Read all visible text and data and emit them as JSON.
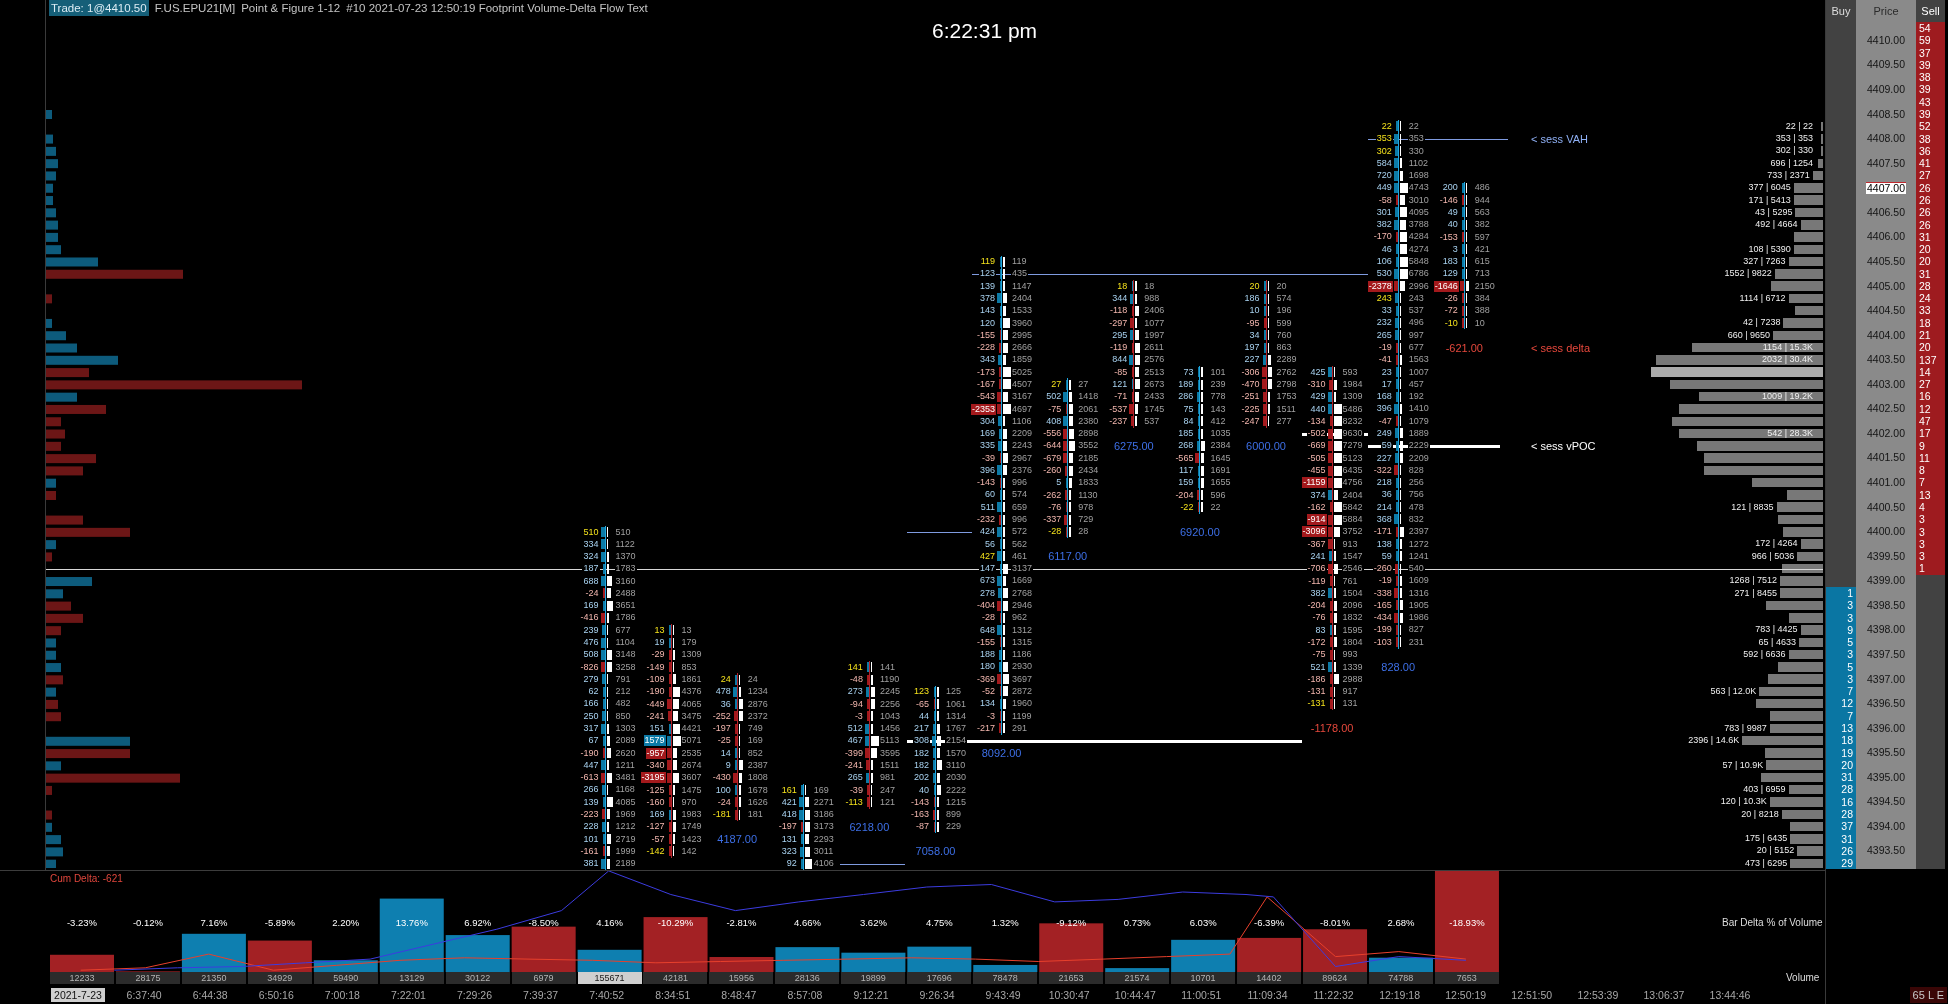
{
  "header": {
    "trade": "Trade: 1@4410.50",
    "instrument": "F.US.EPU21[M]",
    "chart_type": "Point & Figure 1-12",
    "description": "#10 2021-07-23 12:50:19 Footprint Volume-Delta Flow Text"
  },
  "clock": "6:22:31 pm",
  "footprint": {
    "columns": [
      {
        "rising": true,
        "rows": [
          [
            "510",
            "510",
            true
          ],
          [
            "334",
            "1122",
            false
          ],
          [
            "324",
            "1370",
            false
          ],
          [
            "187",
            "1783",
            false
          ],
          [
            "688",
            "3160",
            false
          ],
          [
            "-24",
            "2488",
            false
          ],
          [
            "169",
            "3651",
            false
          ],
          [
            "-416",
            "1786",
            false
          ],
          [
            "239",
            "677",
            false
          ],
          [
            "476",
            "1104",
            false
          ],
          [
            "508",
            "3148",
            false
          ],
          [
            "-826",
            "3258",
            false
          ],
          [
            "279",
            "791",
            false
          ],
          [
            "62",
            "212",
            false
          ],
          [
            "166",
            "482",
            false
          ],
          [
            "250",
            "850",
            false
          ],
          [
            "317",
            "1303",
            false
          ],
          [
            "67",
            "2089",
            false
          ],
          [
            "-190",
            "2620",
            false
          ],
          [
            "447",
            "1211",
            false
          ],
          [
            "-613",
            "3481",
            false
          ],
          [
            "266",
            "1168",
            false
          ],
          [
            "139",
            "4085",
            false
          ],
          [
            "-223",
            "1969",
            false
          ],
          [
            "228",
            "1212",
            false
          ],
          [
            "101",
            "2719",
            false
          ],
          [
            "-161",
            "1999",
            false
          ],
          [
            "381",
            "2189",
            false
          ]
        ]
      },
      {
        "rising": false,
        "rows": [
          [
            "13",
            "13",
            true
          ],
          [
            "19",
            "179",
            false
          ],
          [
            "-29",
            "1309",
            false
          ],
          [
            "-149",
            "853",
            false
          ],
          [
            "-109",
            "1861",
            false
          ],
          [
            "-190",
            "4376",
            false
          ],
          [
            "-449",
            "4065",
            false
          ],
          [
            "-241",
            "3475",
            false
          ],
          [
            "151",
            "4421",
            false
          ],
          [
            "1579",
            "5071",
            false
          ],
          [
            "-957",
            "2535",
            false
          ],
          [
            "-340",
            "2674",
            false
          ],
          [
            "-3195",
            "3607",
            false
          ],
          [
            "-125",
            "1475",
            false
          ],
          [
            "-160",
            "970",
            false
          ],
          [
            "169",
            "1983",
            false
          ],
          [
            "-127",
            "1749",
            false
          ],
          [
            "-57",
            "1423",
            false
          ],
          [
            "-142",
            "142",
            true
          ]
        ]
      },
      {
        "rising": false,
        "rows": [
          [
            "24",
            "24",
            true
          ],
          [
            "478",
            "1234",
            false
          ],
          [
            "36",
            "2876",
            false
          ],
          [
            "-252",
            "2372",
            false
          ],
          [
            "-197",
            "749",
            false
          ],
          [
            "-25",
            "169",
            false
          ],
          [
            "14",
            "852",
            false
          ],
          [
            "9",
            "2387",
            false
          ],
          [
            "-430",
            "1808",
            false
          ],
          [
            "100",
            "1678",
            false
          ],
          [
            "-24",
            "1626",
            false
          ],
          [
            "-181",
            "181",
            true
          ]
        ],
        "total": "4187.00"
      },
      {
        "rising": true,
        "rows": [
          [
            "161",
            "169",
            true
          ],
          [
            "421",
            "2271",
            false
          ],
          [
            "418",
            "3186",
            false
          ],
          [
            "-197",
            "3173",
            false
          ],
          [
            "131",
            "2293",
            false
          ],
          [
            "323",
            "3011",
            false
          ],
          [
            "92",
            "4106",
            false
          ]
        ]
      },
      {
        "rising": false,
        "rows": [
          [
            "141",
            "141",
            true
          ],
          [
            "-48",
            "1190",
            false
          ],
          [
            "273",
            "2245",
            false
          ],
          [
            "-94",
            "2256",
            false
          ],
          [
            "-3",
            "1043",
            false
          ],
          [
            "512",
            "1456",
            false
          ],
          [
            "467",
            "5113",
            false
          ],
          [
            "-399",
            "3595",
            false
          ],
          [
            "-241",
            "1511",
            false
          ],
          [
            "265",
            "981",
            false
          ],
          [
            "-39",
            "247",
            false
          ],
          [
            "-113",
            "121",
            true
          ]
        ],
        "total": "6218.00"
      },
      {
        "rising": true,
        "rows": [
          [
            "123",
            "125",
            true
          ],
          [
            "-65",
            "1061",
            false
          ],
          [
            "44",
            "1314",
            false
          ],
          [
            "217",
            "1767",
            false
          ],
          [
            "308",
            "2154",
            false
          ],
          [
            "182",
            "1570",
            false
          ],
          [
            "182",
            "3110",
            false
          ],
          [
            "202",
            "2030",
            false
          ],
          [
            "40",
            "2222",
            false
          ],
          [
            "-143",
            "1215",
            false
          ],
          [
            "-163",
            "899",
            false
          ],
          [
            "-87",
            "229",
            false
          ]
        ],
        "total": "7058.00"
      },
      {
        "rising": true,
        "rows": [
          [
            "119",
            "119",
            true
          ],
          [
            "123",
            "435",
            false
          ],
          [
            "139",
            "1147",
            false
          ],
          [
            "378",
            "2404",
            false
          ],
          [
            "143",
            "1533",
            false
          ],
          [
            "120",
            "3960",
            false
          ],
          [
            "-155",
            "2995",
            false
          ],
          [
            "-228",
            "2666",
            false
          ],
          [
            "343",
            "1859",
            false
          ],
          [
            "-173",
            "5025",
            false
          ],
          [
            "-167",
            "4507",
            false
          ],
          [
            "-543",
            "3167",
            false
          ],
          [
            "-2353",
            "4697",
            false
          ],
          [
            "304",
            "1106",
            false
          ],
          [
            "169",
            "2209",
            false
          ],
          [
            "335",
            "2243",
            false
          ],
          [
            "-39",
            "2967",
            false
          ],
          [
            "396",
            "2376",
            false
          ],
          [
            "-143",
            "996",
            false
          ],
          [
            "60",
            "574",
            false
          ],
          [
            "511",
            "659",
            false
          ],
          [
            "-232",
            "996",
            false
          ],
          [
            "424",
            "572",
            false
          ],
          [
            "56",
            "562",
            false
          ],
          [
            "427",
            "461",
            true
          ],
          [
            "147",
            "3137",
            false
          ],
          [
            "673",
            "1669",
            false
          ],
          [
            "278",
            "2768",
            false
          ],
          [
            "-404",
            "2946",
            false
          ],
          [
            "-28",
            "962",
            false
          ],
          [
            "648",
            "1312",
            false
          ],
          [
            "-155",
            "1315",
            false
          ],
          [
            "188",
            "1186",
            false
          ],
          [
            "180",
            "2930",
            false
          ],
          [
            "-369",
            "3697",
            false
          ],
          [
            "-52",
            "2872",
            false
          ],
          [
            "134",
            "1960",
            false
          ],
          [
            "-3",
            "1199",
            false
          ],
          [
            "-217",
            "291",
            false
          ]
        ],
        "total": "8092.00"
      },
      {
        "rising": true,
        "rows": [
          [
            "27",
            "27",
            true
          ],
          [
            "502",
            "1418",
            false
          ],
          [
            "-75",
            "2061",
            false
          ],
          [
            "408",
            "2380",
            false
          ],
          [
            "-556",
            "2898",
            false
          ],
          [
            "-644",
            "3552",
            false
          ],
          [
            "-679",
            "2185",
            false
          ],
          [
            "-260",
            "2434",
            false
          ],
          [
            "5",
            "1833",
            false
          ],
          [
            "-262",
            "1130",
            false
          ],
          [
            "-76",
            "978",
            false
          ],
          [
            "-337",
            "729",
            false
          ],
          [
            "-28",
            "28",
            true
          ]
        ],
        "total": "6117.00"
      },
      {
        "rising": false,
        "rows": [
          [
            "18",
            "18",
            true
          ],
          [
            "344",
            "988",
            false
          ],
          [
            "-118",
            "2406",
            false
          ],
          [
            "-297",
            "1077",
            false
          ],
          [
            "295",
            "1997",
            false
          ],
          [
            "-119",
            "2611",
            false
          ],
          [
            "844",
            "2576",
            false
          ],
          [
            "-85",
            "2513",
            false
          ],
          [
            "121",
            "2673",
            false
          ],
          [
            "-71",
            "2433",
            false
          ],
          [
            "-537",
            "1745",
            false
          ],
          [
            "-237",
            "537",
            false
          ]
        ],
        "total": "6275.00"
      },
      {
        "rising": true,
        "rows": [
          [
            "73",
            "101",
            false
          ],
          [
            "189",
            "239",
            false
          ],
          [
            "286",
            "778",
            false
          ],
          [
            "75",
            "143",
            false
          ],
          [
            "84",
            "412",
            false
          ],
          [
            "185",
            "1035",
            false
          ],
          [
            "268",
            "2384",
            false
          ],
          [
            "-565",
            "1645",
            false
          ],
          [
            "117",
            "1691",
            false
          ],
          [
            "159",
            "1655",
            false
          ],
          [
            "-204",
            "596",
            false
          ],
          [
            "-22",
            "22",
            true
          ]
        ],
        "total": "6920.00"
      },
      {
        "rising": false,
        "rows": [
          [
            "20",
            "20",
            true
          ],
          [
            "186",
            "574",
            false
          ],
          [
            "10",
            "196",
            false
          ],
          [
            "-95",
            "599",
            false
          ],
          [
            "34",
            "760",
            false
          ],
          [
            "197",
            "863",
            false
          ],
          [
            "227",
            "2289",
            false
          ],
          [
            "-306",
            "2762",
            false
          ],
          [
            "-470",
            "2798",
            false
          ],
          [
            "-251",
            "1753",
            false
          ],
          [
            "-225",
            "1511",
            false
          ],
          [
            "-247",
            "277",
            false
          ]
        ],
        "total": "6000.00"
      },
      {
        "rising": false,
        "rows": [
          [
            "425",
            "593",
            false
          ],
          [
            "-310",
            "1984",
            false
          ],
          [
            "429",
            "1309",
            false
          ],
          [
            "440",
            "5486",
            false
          ],
          [
            "-134",
            "8232",
            false
          ],
          [
            "-502",
            "9630",
            false
          ],
          [
            "-669",
            "7279",
            false
          ],
          [
            "-505",
            "5123",
            false
          ],
          [
            "-455",
            "6435",
            false
          ],
          [
            "-1159",
            "4756",
            false
          ],
          [
            "374",
            "2404",
            false
          ],
          [
            "-162",
            "5842",
            false
          ],
          [
            "-914",
            "5884",
            false
          ],
          [
            "-3096",
            "3752",
            false
          ],
          [
            "-367",
            "913",
            false
          ],
          [
            "241",
            "1547",
            false
          ],
          [
            "-706",
            "2546",
            false
          ],
          [
            "-119",
            "761",
            false
          ],
          [
            "382",
            "1504",
            false
          ],
          [
            "-204",
            "2096",
            false
          ],
          [
            "-76",
            "1832",
            false
          ],
          [
            "83",
            "1595",
            false
          ],
          [
            "-172",
            "1804",
            false
          ],
          [
            "-75",
            "993",
            false
          ],
          [
            "521",
            "1339",
            false
          ],
          [
            "-186",
            "2988",
            false
          ],
          [
            "-131",
            "917",
            false
          ],
          [
            "-131",
            "131",
            true
          ]
        ],
        "total": "-1178.00"
      },
      {
        "rising": true,
        "rows": [
          [
            "22",
            "22",
            true
          ],
          [
            "353",
            "353",
            true
          ],
          [
            "302",
            "330",
            true
          ],
          [
            "584",
            "1102",
            false
          ],
          [
            "720",
            "1698",
            false
          ],
          [
            "449",
            "4743",
            false
          ],
          [
            "-58",
            "3010",
            false
          ],
          [
            "301",
            "4095",
            false
          ],
          [
            "382",
            "3788",
            false
          ],
          [
            "-170",
            "4284",
            false
          ],
          [
            "46",
            "4274",
            false
          ],
          [
            "106",
            "5848",
            false
          ],
          [
            "530",
            "6786",
            false
          ],
          [
            "-2378",
            "2996",
            false
          ],
          [
            "243",
            "243",
            true
          ],
          [
            "33",
            "537",
            false
          ],
          [
            "232",
            "496",
            false
          ],
          [
            "265",
            "997",
            false
          ],
          [
            "-19",
            "677",
            false
          ],
          [
            "-41",
            "1563",
            false
          ],
          [
            "23",
            "1007",
            false
          ],
          [
            "17",
            "457",
            false
          ],
          [
            "168",
            "192",
            false
          ],
          [
            "396",
            "1410",
            false
          ],
          [
            "-47",
            "1079",
            false
          ],
          [
            "249",
            "1889",
            false
          ],
          [
            "59",
            "2229",
            false
          ],
          [
            "227",
            "2209",
            false
          ],
          [
            "-322",
            "828",
            false
          ],
          [
            "218",
            "256",
            false
          ],
          [
            "36",
            "756",
            false
          ],
          [
            "214",
            "478",
            false
          ],
          [
            "368",
            "832",
            false
          ],
          [
            "-171",
            "2397",
            false
          ],
          [
            "138",
            "1272",
            false
          ],
          [
            "59",
            "1241",
            false
          ],
          [
            "-260",
            "540",
            false
          ],
          [
            "-19",
            "1609",
            false
          ],
          [
            "-338",
            "1316",
            false
          ],
          [
            "-165",
            "1905",
            false
          ],
          [
            "-434",
            "1986",
            false
          ],
          [
            "-199",
            "827",
            false
          ],
          [
            "-103",
            "231",
            false
          ]
        ],
        "total": "828.00"
      },
      {
        "rising": true,
        "rows": [
          [
            "200",
            "486",
            false
          ],
          [
            "-146",
            "944",
            false
          ],
          [
            "49",
            "563",
            false
          ],
          [
            "40",
            "382",
            false
          ],
          [
            "-153",
            "597",
            false
          ],
          [
            "3",
            "421",
            false
          ],
          [
            "183",
            "615",
            false
          ],
          [
            "129",
            "713",
            false
          ],
          [
            "-1646",
            "2150",
            false
          ],
          [
            "-26",
            "384",
            false
          ],
          [
            "-72",
            "388",
            false
          ],
          [
            "-10",
            "10",
            true
          ]
        ],
        "total": "-621.00"
      }
    ]
  },
  "annotations": [
    {
      "kind": "vah",
      "text": "< sess VAH"
    },
    {
      "kind": "delta",
      "text": "< sess delta"
    },
    {
      "kind": "vpoc",
      "text": "< sess vPOC"
    }
  ],
  "ladder": {
    "headers": [
      "Buy",
      "Price",
      "Sell"
    ],
    "rows": [
      {
        "sell": "54",
        "selected": false
      },
      {
        "price": "4410.00",
        "sell": "59",
        "selected": false
      },
      {
        "sell": "37",
        "selected": false
      },
      {
        "price": "4409.50",
        "sell": "39",
        "selected": false
      },
      {
        "sell": "38",
        "selected": false
      },
      {
        "price": "4409.00",
        "sell": "39",
        "selected": false
      },
      {
        "sell": "43",
        "selected": false
      },
      {
        "price": "4408.50",
        "sell": "39",
        "selected": false
      },
      {
        "profile": "22 | 22",
        "level": 0.01,
        "sell": "52",
        "selected": false
      },
      {
        "profile": "353 | 353",
        "level": 0.01,
        "price": "4408.00",
        "sell": "38",
        "selected": false
      },
      {
        "profile": "302 | 330",
        "level": 0.01,
        "sell": "36",
        "selected": false
      },
      {
        "profile": "696 | 1254",
        "level": 0.03,
        "price": "4407.50",
        "sell": "41",
        "selected": false
      },
      {
        "profile": "733 | 2371",
        "level": 0.06,
        "sell": "27",
        "selected": false
      },
      {
        "profile": "377 | 6045",
        "level": 0.17,
        "price": "4407.00",
        "sell": "26",
        "selected": true
      },
      {
        "profile": "171 | 5413",
        "level": 0.17,
        "sell": "26",
        "selected": false
      },
      {
        "profile": "43 | 5295",
        "level": 0.16,
        "price": "4406.50",
        "sell": "26",
        "selected": false
      },
      {
        "profile": "492 | 4664",
        "level": 0.13,
        "sell": "26",
        "selected": false
      },
      {
        "level": 0.17,
        "price": "4406.00",
        "sell": "31",
        "selected": false
      },
      {
        "profile": "108 | 5390",
        "level": 0.17,
        "sell": "20",
        "selected": false
      },
      {
        "profile": "327 | 7263",
        "level": 0.2,
        "price": "4405.50",
        "sell": "20",
        "selected": false
      },
      {
        "profile": "1552 | 9822",
        "level": 0.28,
        "sell": "31",
        "selected": false
      },
      {
        "level": 0.3,
        "price": "4405.00",
        "sell": "28",
        "selected": false
      },
      {
        "profile": "1114 | 6712",
        "level": 0.2,
        "sell": "24",
        "selected": false
      },
      {
        "level": 0.16,
        "price": "4404.50",
        "sell": "33",
        "selected": false
      },
      {
        "profile": "42 | 7238",
        "level": 0.23,
        "sell": "18",
        "selected": false
      },
      {
        "profile": "660 | 9650",
        "level": 0.29,
        "price": "4404.00",
        "sell": "21",
        "selected": false
      },
      {
        "profile": "1154 | 15.3K",
        "level": 0.76,
        "sell": "20",
        "selected": false
      },
      {
        "profile": "2032 | 30.4K",
        "level": 0.97,
        "price": "4403.50",
        "sell": "137",
        "selected": false
      },
      {
        "level": 1,
        "sell": "14",
        "selected": false
      },
      {
        "level": 0.89,
        "price": "4403.00",
        "sell": "27",
        "selected": false
      },
      {
        "profile": "1009 | 19.2K",
        "level": 0.72,
        "sell": "16",
        "selected": false
      },
      {
        "level": 0.84,
        "price": "4402.50",
        "sell": "12",
        "selected": false
      },
      {
        "level": 0.88,
        "sell": "47",
        "selected": false
      },
      {
        "profile": "542 | 28.3K",
        "level": 0.84,
        "price": "4402.00",
        "sell": "17",
        "selected": false
      },
      {
        "level": 0.73,
        "sell": "9",
        "selected": false
      },
      {
        "level": 0.69,
        "price": "4401.50",
        "sell": "11",
        "selected": false
      },
      {
        "level": 0.69,
        "sell": "8",
        "selected": false
      },
      {
        "level": 0.41,
        "price": "4401.00",
        "sell": "7",
        "selected": false
      },
      {
        "level": 0.21,
        "sell": "13",
        "selected": false
      },
      {
        "profile": "121 | 8835",
        "level": 0.27,
        "price": "4400.50",
        "sell": "4",
        "selected": false
      },
      {
        "level": 0.26,
        "sell": "3",
        "selected": false
      },
      {
        "level": 0.23,
        "price": "4400.00",
        "sell": "3",
        "selected": false
      },
      {
        "profile": "172 | 4264",
        "level": 0.13,
        "sell": "3",
        "selected": false
      },
      {
        "profile": "966 | 5036",
        "level": 0.15,
        "price": "4399.50",
        "sell": "3",
        "selected": false
      },
      {
        "level": 0.24,
        "sell": "1",
        "selected": false
      },
      {
        "profile": "1268 | 7512",
        "level": 0.25,
        "price": "4399.00",
        "selected": false
      },
      {
        "profile": "271 | 8455",
        "level": 0.25,
        "buy": "1",
        "selected": false
      },
      {
        "level": 0.33,
        "price": "4398.50",
        "buy": "3",
        "selected": false
      },
      {
        "level": 0.2,
        "buy": "3",
        "selected": false
      },
      {
        "profile": "783 | 4425",
        "level": 0.13,
        "price": "4398.00",
        "buy": "9",
        "selected": false
      },
      {
        "profile": "65 | 4633",
        "level": 0.14,
        "buy": "5",
        "selected": false
      },
      {
        "profile": "592 | 6636",
        "level": 0.2,
        "price": "4397.50",
        "buy": "3",
        "selected": false
      },
      {
        "level": 0.26,
        "buy": "5",
        "selected": false
      },
      {
        "level": 0.32,
        "price": "4397.00",
        "buy": "3",
        "selected": false
      },
      {
        "profile": "563 | 12.0K",
        "level": 0.37,
        "buy": "7",
        "selected": false
      },
      {
        "level": 0.39,
        "price": "4396.50",
        "buy": "12",
        "selected": false
      },
      {
        "level": 0.31,
        "buy": "7",
        "selected": false
      },
      {
        "profile": "783 | 9987",
        "level": 0.31,
        "price": "4396.00",
        "buy": "13",
        "selected": false
      },
      {
        "profile": "2396 | 14.6K",
        "level": 0.47,
        "buy": "18",
        "selected": false
      },
      {
        "level": 0.34,
        "price": "4395.50",
        "buy": "19",
        "selected": false
      },
      {
        "profile": "57 | 10.9K",
        "level": 0.33,
        "buy": "20",
        "selected": false
      },
      {
        "level": 0.36,
        "price": "4395.00",
        "buy": "31",
        "selected": false
      },
      {
        "profile": "403 | 6959",
        "level": 0.2,
        "buy": "28",
        "selected": false
      },
      {
        "profile": "120 | 10.3K",
        "level": 0.31,
        "price": "4394.50",
        "buy": "16",
        "selected": false
      },
      {
        "profile": "20 | 8218",
        "level": 0.24,
        "buy": "28",
        "selected": false
      },
      {
        "level": 0.19,
        "price": "4394.00",
        "buy": "37",
        "selected": false
      },
      {
        "profile": "175 | 6435",
        "level": 0.19,
        "buy": "31",
        "selected": false
      },
      {
        "profile": "20 | 5152",
        "level": 0.15,
        "price": "4393.50",
        "buy": "26",
        "selected": false
      },
      {
        "profile": "473 | 6295",
        "level": 0.19,
        "buy": "29",
        "selected": false
      }
    ],
    "footer": "65 L E"
  },
  "bottom_panel": {
    "cum_delta": "Cum Delta: -621",
    "title": "Bar Delta % of Volume",
    "bars": [
      {
        "label": "-3.23%",
        "volume": "12233",
        "highlight": false
      },
      {
        "label": "-0.12%",
        "volume": "28175",
        "highlight": false
      },
      {
        "label": "7.16%",
        "volume": "21350",
        "highlight": false
      },
      {
        "label": "-5.89%",
        "volume": "34929",
        "highlight": false
      },
      {
        "label": "2.20%",
        "volume": "59490",
        "highlight": false
      },
      {
        "label": "13.76%",
        "volume": "13129",
        "highlight": false
      },
      {
        "label": "6.92%",
        "volume": "30122",
        "highlight": false
      },
      {
        "label": "-8.50%",
        "volume": "6979",
        "highlight": false
      },
      {
        "label": "4.16%",
        "volume": "155671",
        "highlight": true
      },
      {
        "label": "-10.29%",
        "volume": "42181",
        "highlight": false
      },
      {
        "label": "-2.81%",
        "volume": "15956",
        "highlight": false
      },
      {
        "label": "4.66%",
        "volume": "28136",
        "highlight": false
      },
      {
        "label": "3.62%",
        "volume": "19899",
        "highlight": false
      },
      {
        "label": "4.75%",
        "volume": "17696",
        "highlight": false
      },
      {
        "label": "1.32%",
        "volume": "78478",
        "highlight": false
      },
      {
        "label": "-9.12%",
        "volume": "21653",
        "highlight": false
      },
      {
        "label": "0.73%",
        "volume": "21574",
        "highlight": false
      },
      {
        "label": "6.03%",
        "volume": "10701",
        "highlight": false
      },
      {
        "label": "-6.39%",
        "volume": "14402",
        "highlight": false
      },
      {
        "label": "-8.01%",
        "volume": "89624",
        "highlight": false
      },
      {
        "label": "2.68%",
        "volume": "74788",
        "highlight": false
      },
      {
        "label": "-18.93%",
        "volume": "7653",
        "highlight": false
      }
    ],
    "volume_label": "Volume"
  },
  "time_axis": [
    {
      "text": "2021-7-23",
      "selected": true
    },
    {
      "text": "6:37:40",
      "selected": false
    },
    {
      "text": "6:44:38",
      "selected": false
    },
    {
      "text": "6:50:16",
      "selected": false
    },
    {
      "text": "7:00:18",
      "selected": false
    },
    {
      "text": "7:22:01",
      "selected": false
    },
    {
      "text": "7:29:26",
      "selected": false
    },
    {
      "text": "7:39:37",
      "selected": false
    },
    {
      "text": "7:40:52",
      "selected": false
    },
    {
      "text": "8:34:51",
      "selected": false
    },
    {
      "text": "8:48:47",
      "selected": false
    },
    {
      "text": "8:57:08",
      "selected": false
    },
    {
      "text": "9:12:21",
      "selected": false
    },
    {
      "text": "9:26:34",
      "selected": false
    },
    {
      "text": "9:43:49",
      "selected": false
    },
    {
      "text": "10:30:47",
      "selected": false
    },
    {
      "text": "10:44:47",
      "selected": false
    },
    {
      "text": "11:00:51",
      "selected": false
    },
    {
      "text": "11:09:34",
      "selected": false
    },
    {
      "text": "11:22:32",
      "selected": false
    },
    {
      "text": "12:19:18",
      "selected": false
    },
    {
      "text": "12:50:19",
      "selected": false
    },
    {
      "text": "12:51:50",
      "selected": false
    },
    {
      "text": "12:53:39",
      "selected": false
    },
    {
      "text": "13:06:37",
      "selected": false
    },
    {
      "text": "13:44:46",
      "selected": false
    }
  ]
}
